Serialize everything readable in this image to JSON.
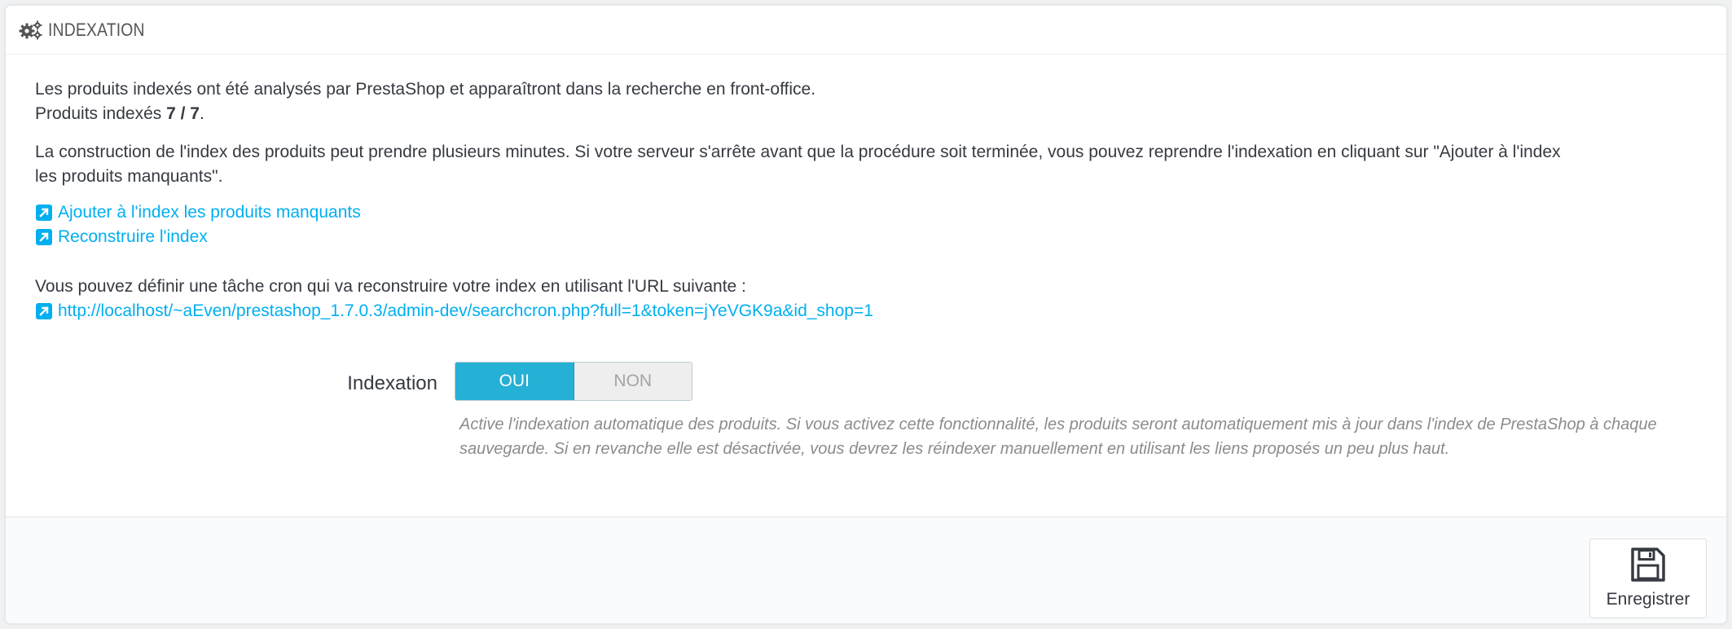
{
  "panel": {
    "title": "INDEXATION",
    "title_icon": "cogs-icon"
  },
  "intro": {
    "line1": "Les produits indexés ont été analysés par PrestaShop et apparaîtront dans la recherche en front-office.",
    "indexed_prefix": "Produits indexés ",
    "indexed_count": "7 / 7",
    "indexed_suffix": "."
  },
  "note": {
    "line1": "La construction de l'index des produits peut prendre plusieurs minutes. Si votre serveur s'arrête avant que la procédure soit terminée, vous pouvez reprendre l'indexation en cliquant sur \"Ajouter à l'index",
    "line2": "les produits manquants\"."
  },
  "links": {
    "add_missing": "Ajouter à l'index les produits manquants",
    "rebuild": "Reconstruire l'index",
    "link_icon": "external-link-icon"
  },
  "cron": {
    "text": "Vous pouvez définir une tâche cron qui va reconstruire votre index en utilisant l'URL suivante :",
    "url": "http://localhost/~aEven/prestashop_1.7.0.3/admin-dev/searchcron.php?full=1&token=jYeVGK9a&id_shop=1"
  },
  "form": {
    "label": "Indexation",
    "on_label": "OUI",
    "off_label": "NON",
    "selected": "OUI",
    "help": "Active l'indexation automatique des produits. Si vous activez cette fonctionnalité, les produits seront automatiquement mis à jour dans l'index de PrestaShop à chaque sauvegarde. Si en revanche elle est désactivée, vous devrez les réindexer manuellement en utilisant les liens proposés un peu plus haut."
  },
  "footer": {
    "save_label": "Enregistrer",
    "save_icon": "floppy-disk-icon"
  },
  "colors": {
    "link": "#00aff0",
    "switch_on": "#25b0d5",
    "help_text": "#8c8c8c"
  }
}
